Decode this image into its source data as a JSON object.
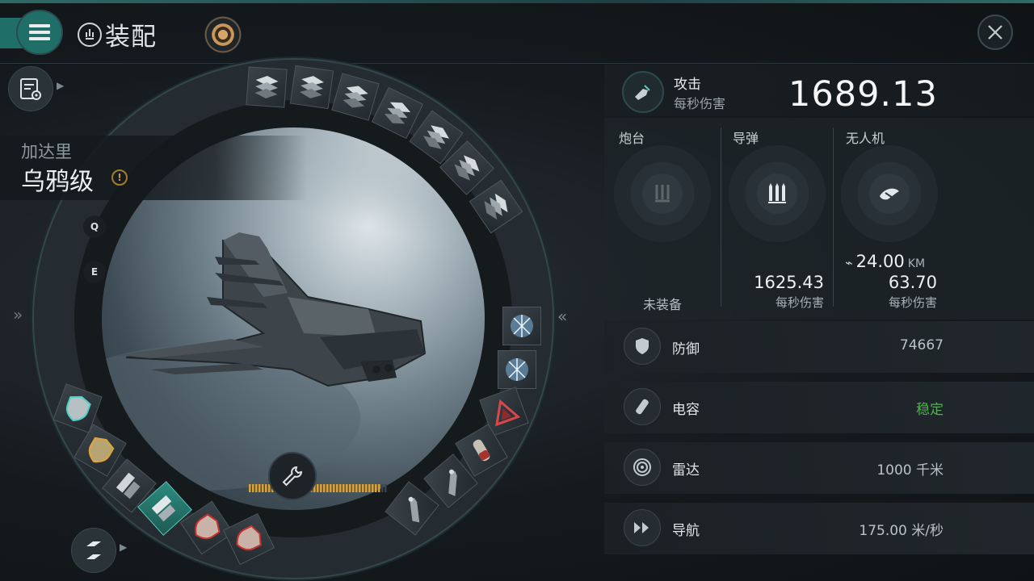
{
  "header": {
    "title": "装配",
    "title_icon": "fitting-icon",
    "close_icon": "close-icon",
    "menu_icon": "menu-icon"
  },
  "ship": {
    "race": "加达里",
    "name": "乌鸦级",
    "warning_icon": "!"
  },
  "hotkeys": {
    "q": "Q",
    "e": "E"
  },
  "side_chevrons": {
    "left": "»",
    "right": "«"
  },
  "attack": {
    "label": "攻击",
    "sub": "每秒伤害",
    "value": "1689.13"
  },
  "weapons": {
    "turret": {
      "title": "炮台",
      "status": "未装备"
    },
    "missile": {
      "title": "导弹",
      "value": "1625.43",
      "sub": "每秒伤害"
    },
    "drone": {
      "title": "无人机",
      "range_value": "24.00",
      "range_unit": "KM",
      "value": "63.70",
      "sub": "每秒伤害"
    }
  },
  "stats": [
    {
      "label": "防御",
      "value": "74667",
      "icon": "shield-icon"
    },
    {
      "label": "电容",
      "value": "稳定",
      "icon": "capacitor-icon"
    },
    {
      "label": "雷达",
      "value": "1000 千米",
      "icon": "radar-icon"
    },
    {
      "label": "导航",
      "value": "175.00 米/秒",
      "icon": "navigation-icon"
    }
  ],
  "colors": {
    "accent": "#1f6f68",
    "stable_green": "#4fb24a",
    "capacitor_amber": "#d9a33a"
  },
  "capacitor_fill": 0.95
}
